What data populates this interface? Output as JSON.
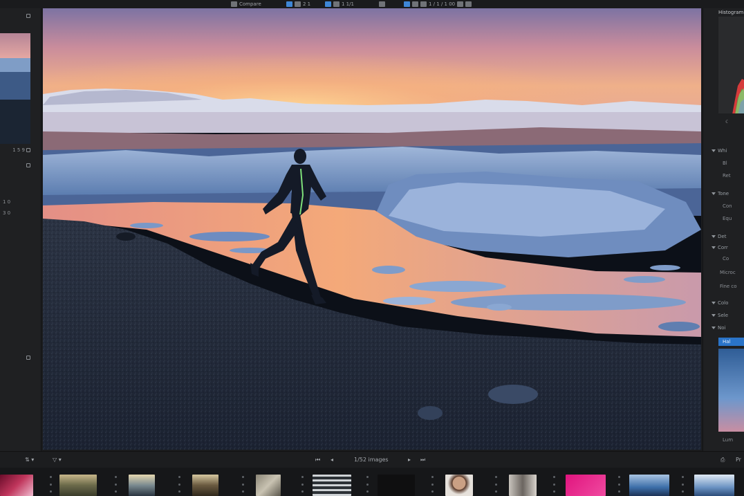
{
  "toolbar": {
    "label_a": "Compare",
    "counter_a": "2 1",
    "counter_b": "1 1/1",
    "counter_c": "1 / 1 / 1 00"
  },
  "left_panel": {
    "text_a": "1 5 9",
    "text_b": "1 0",
    "text_c": "3 0"
  },
  "right_panel": {
    "title": "Histogram",
    "sections": [
      "Whi",
      "Tone",
      "Det",
      "Corr",
      "Colo",
      "Sele",
      "Noi"
    ],
    "items": [
      "Bl",
      "Ret",
      "Con",
      "Equ",
      "Co",
      "Microc",
      "Fine co",
      "Lum"
    ],
    "tab_label": "Hal",
    "preview_caption": "Lum"
  },
  "filmbar": {
    "image_count": "1/52 images",
    "right_label": "Pr"
  },
  "colors": {
    "accent": "#3e86d6",
    "panel": "#1f2022",
    "filmstrip": "#161719"
  }
}
